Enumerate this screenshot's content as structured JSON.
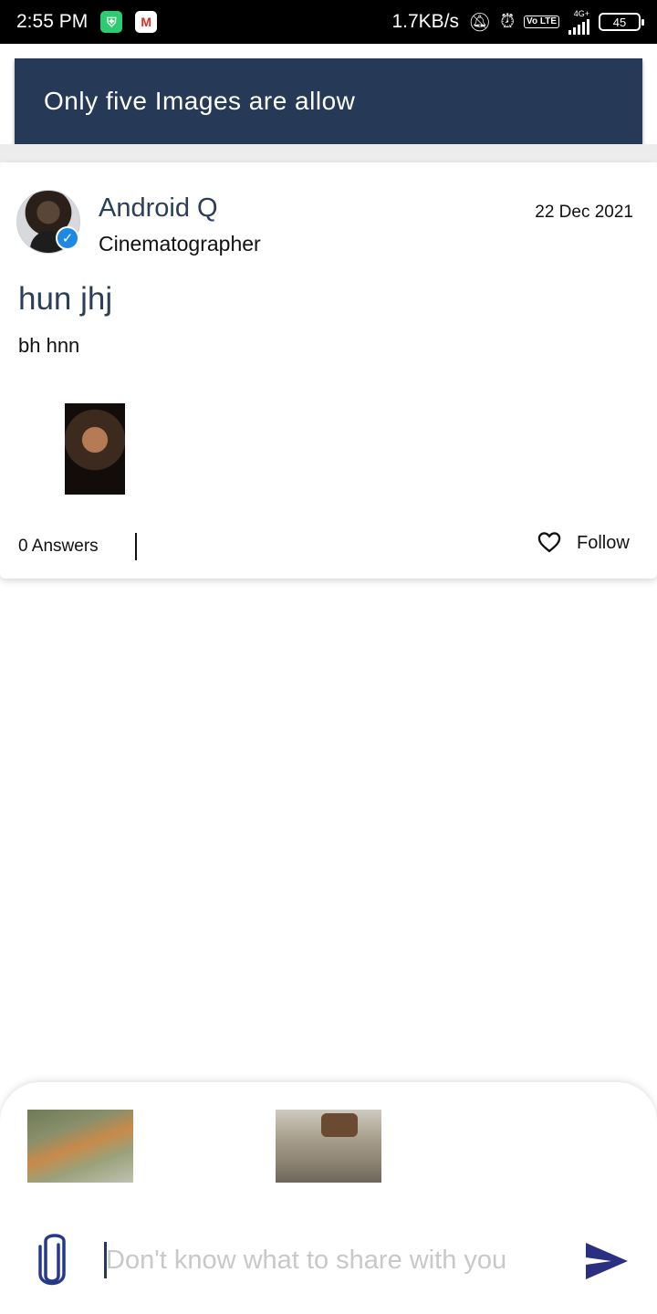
{
  "status_bar": {
    "time": "2:55 PM",
    "speed": "1.7KB/s",
    "network": "4G+",
    "volte": "Vo LTE",
    "battery": "45"
  },
  "toast": {
    "message": "Only five Images are allow"
  },
  "post": {
    "author_name": "Android Q",
    "author_role": "Cinematographer",
    "date": "22 Dec 2021",
    "title": "hun jhj",
    "body": "bh hnn",
    "answers_label": "0 Answers",
    "follow_label": "Follow"
  },
  "composer": {
    "placeholder": "Don't know what to share with you"
  },
  "colors": {
    "accent": "#263a57",
    "send": "#2b2f80"
  }
}
